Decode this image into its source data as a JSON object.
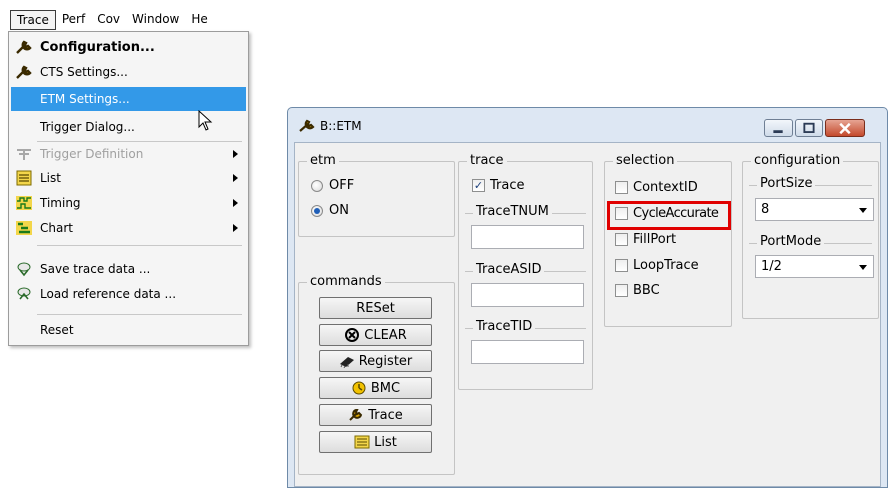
{
  "menubar": {
    "items": [
      "Trace",
      "Perf",
      "Cov",
      "Window",
      "He"
    ]
  },
  "dropdown": {
    "items": [
      {
        "label": "Configuration...",
        "icon": "wrench-icon",
        "bold": true
      },
      {
        "label": "CTS Settings...",
        "icon": "wrench-icon"
      },
      {
        "label": "ETM Settings...",
        "highlighted": true
      },
      {
        "label": "Trigger Dialog..."
      },
      {
        "label": "Trigger Definition",
        "icon": "trigger-icon",
        "disabled": true,
        "submenu": true
      },
      {
        "label": "List",
        "icon": "list-icon",
        "submenu": true
      },
      {
        "label": "Timing",
        "icon": "timing-icon",
        "submenu": true
      },
      {
        "label": "Chart",
        "icon": "chart-icon",
        "submenu": true
      },
      {
        "label": "Save trace data ...",
        "icon": "save-icon"
      },
      {
        "label": "Load reference data ...",
        "icon": "load-icon"
      },
      {
        "label": "Reset"
      }
    ]
  },
  "window": {
    "title": "B::ETM",
    "etm": {
      "title": "etm",
      "options": [
        "OFF",
        "ON"
      ],
      "selected": "ON"
    },
    "commands": {
      "title": "commands",
      "buttons": [
        "RESet",
        "CLEAR",
        "Register",
        "BMC",
        "Trace",
        "List"
      ]
    },
    "trace": {
      "title": "trace",
      "checkbox_label": "Trace",
      "checked": true,
      "fields": [
        "TraceTNUM",
        "TraceASID",
        "TraceTID"
      ]
    },
    "selection": {
      "title": "selection",
      "items": [
        "ContextID",
        "CycleAccurate",
        "FillPort",
        "LoopTrace",
        "BBC"
      ],
      "highlighted": "CycleAccurate"
    },
    "configuration": {
      "title": "configuration",
      "portsize_label": "PortSize",
      "portsize_value": "8",
      "portmode_label": "PortMode",
      "portmode_value": "1/2"
    }
  },
  "colors": {
    "highlight": "#3399e8",
    "annotation_red": "#e00000",
    "window_frame": "#dde7f3"
  }
}
